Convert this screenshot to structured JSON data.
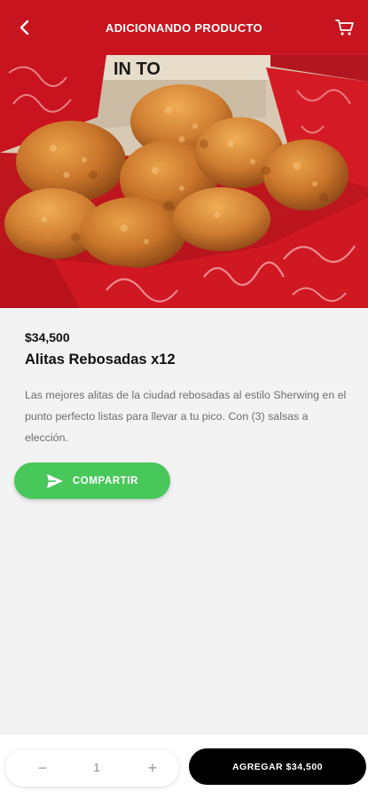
{
  "header": {
    "title": "ADICIONANDO PRODUCTO",
    "back_icon": "chevron-left-icon",
    "cart_icon": "cart-icon",
    "bg_color": "#c8141f"
  },
  "hero": {
    "box_text": "IN TO"
  },
  "product": {
    "price": "$34,500",
    "name": "Alitas Rebosadas x12",
    "description": "Las mejores alitas de la ciudad rebosadas al estilo Sherwing en el punto perfecto listas para llevar a tu pico. Con (3) salsas a elección."
  },
  "share": {
    "label": "COMPARTIR",
    "icon": "send-icon",
    "color": "#48c75a"
  },
  "footer": {
    "minus": "−",
    "quantity": "1",
    "plus": "+",
    "add_label": "AGREGAR $34,500"
  }
}
